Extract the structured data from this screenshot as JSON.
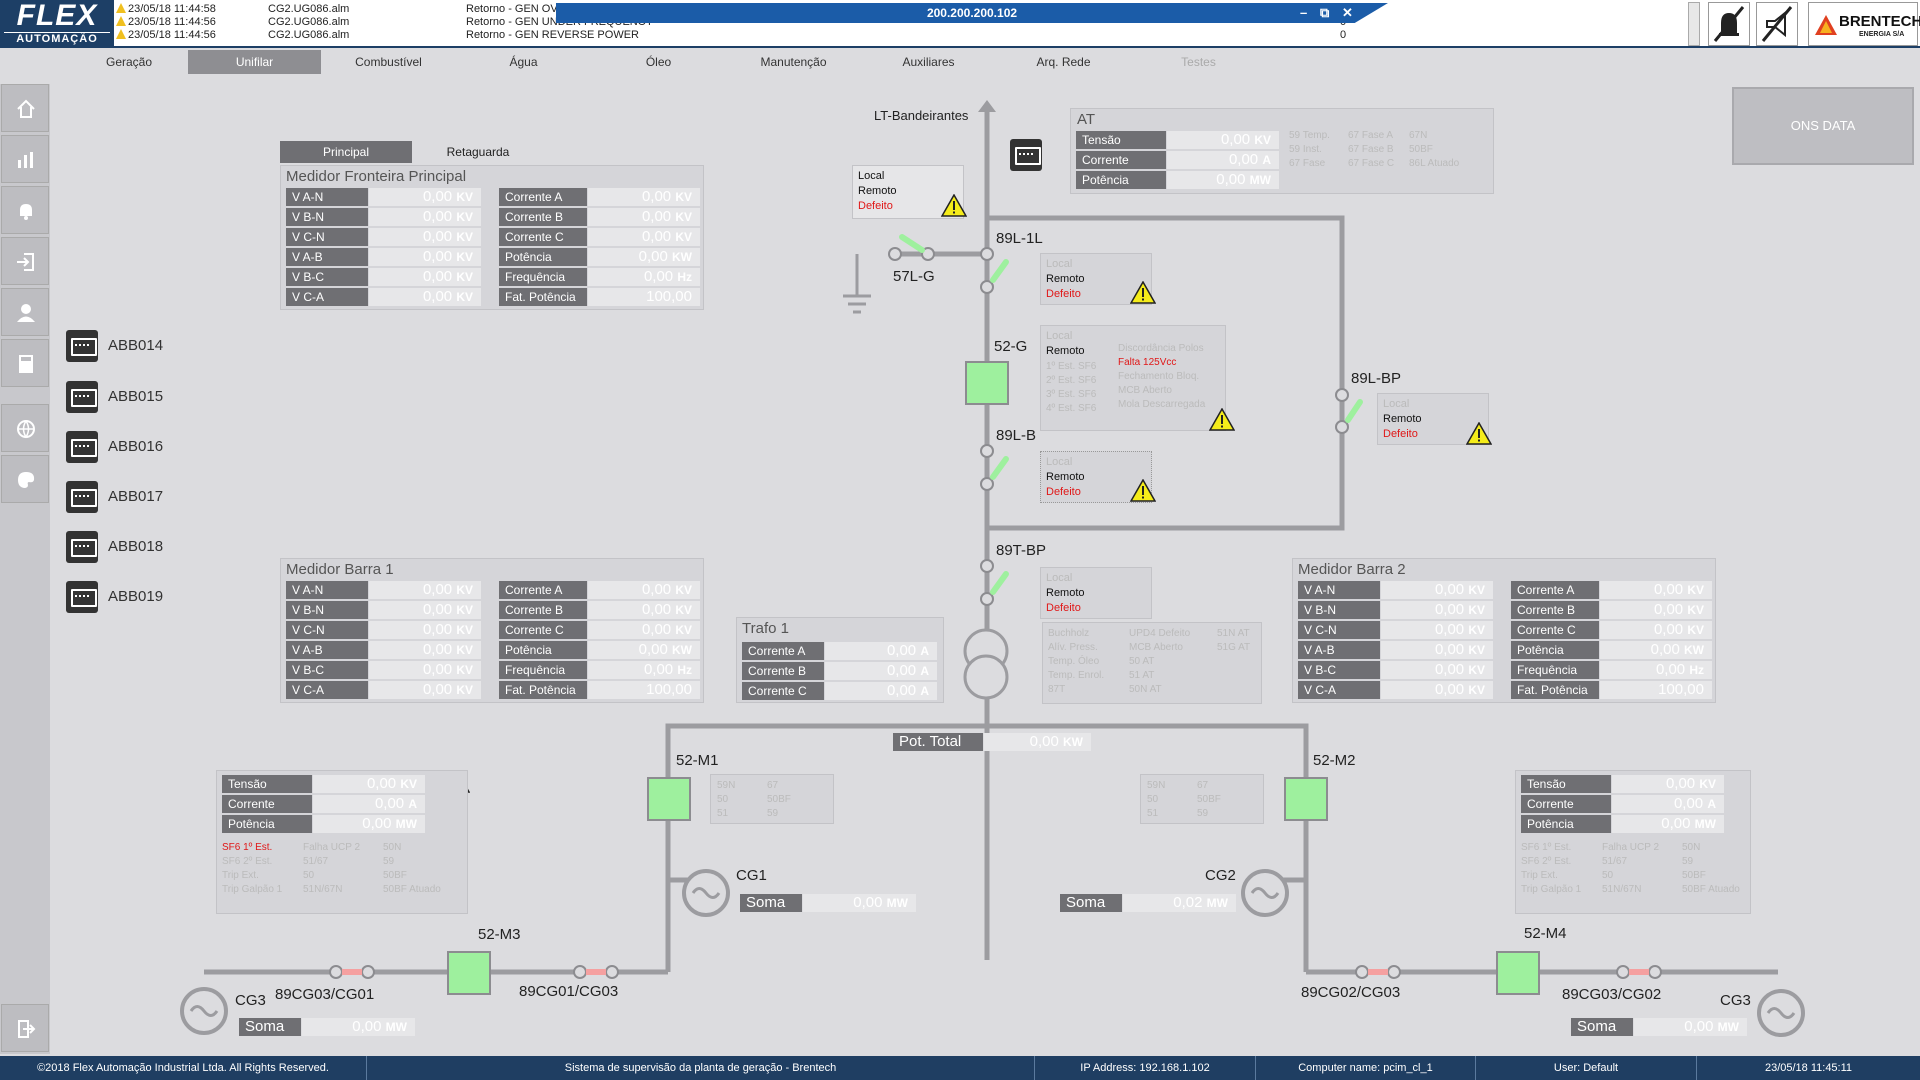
{
  "header": {
    "logo_line1": "FLEX",
    "logo_line2": "AUTOMAÇÃO",
    "ip": "200.200.200.102",
    "window_controls": [
      "–",
      "⧉",
      "✕"
    ],
    "brand": "BRENTECH",
    "brand_sub": "ENERGIA S/A",
    "alarms": [
      {
        "time": "23/05/18 11:44:58",
        "file": "CG2.UG086.alm",
        "msg": "Retorno - GEN OVERCURRENT",
        "val": "0"
      },
      {
        "time": "23/05/18 11:44:56",
        "file": "CG2.UG086.alm",
        "msg": "Retorno - GEN UNDER FREQUENCY",
        "val": "0"
      },
      {
        "time": "23/05/18 11:44:56",
        "file": "CG2.UG086.alm",
        "msg": "Retorno - GEN REVERSE POWER",
        "val": "0"
      }
    ]
  },
  "menu": [
    "Geração",
    "Unifilar",
    "Combustível",
    "Água",
    "Óleo",
    "Manutenção",
    "Auxiliares",
    "Arq. Rede",
    "Testes"
  ],
  "ons": "ONS DATA",
  "devices": [
    "ABB014",
    "ABB015",
    "ABB016",
    "ABB017",
    "ABB018",
    "ABB019"
  ],
  "tabs": {
    "principal": "Principal",
    "retaguarda": "Retaguarda"
  },
  "medidor_principal": {
    "title": "Medidor Fronteira Principal",
    "left": [
      [
        "V A-N",
        "0,00",
        "KV"
      ],
      [
        "V B-N",
        "0,00",
        "KV"
      ],
      [
        "V C-N",
        "0,00",
        "KV"
      ],
      [
        "V A-B",
        "0,00",
        "KV"
      ],
      [
        "V B-C",
        "0,00",
        "KV"
      ],
      [
        "V C-A",
        "0,00",
        "KV"
      ]
    ],
    "right": [
      [
        "Corrente A",
        "0,00",
        "KV"
      ],
      [
        "Corrente B",
        "0,00",
        "KV"
      ],
      [
        "Corrente C",
        "0,00",
        "KV"
      ],
      [
        "Potência",
        "0,00",
        "KW"
      ],
      [
        "Frequência",
        "0,00",
        "Hz"
      ],
      [
        "Fat. Potência",
        "100,00",
        ""
      ]
    ]
  },
  "medidor_barra1": {
    "title": "Medidor Barra 1",
    "left": [
      [
        "V A-N",
        "0,00",
        "KV"
      ],
      [
        "V B-N",
        "0,00",
        "KV"
      ],
      [
        "V C-N",
        "0,00",
        "KV"
      ],
      [
        "V A-B",
        "0,00",
        "KV"
      ],
      [
        "V B-C",
        "0,00",
        "KV"
      ],
      [
        "V C-A",
        "0,00",
        "KV"
      ]
    ],
    "right": [
      [
        "Corrente A",
        "0,00",
        "KV"
      ],
      [
        "Corrente B",
        "0,00",
        "KV"
      ],
      [
        "Corrente C",
        "0,00",
        "KV"
      ],
      [
        "Potência",
        "0,00",
        "KW"
      ],
      [
        "Frequência",
        "0,00",
        "Hz"
      ],
      [
        "Fat. Potência",
        "100,00",
        ""
      ]
    ]
  },
  "medidor_barra2": {
    "title": "Medidor Barra 2",
    "left": [
      [
        "V A-N",
        "0,00",
        "KV"
      ],
      [
        "V B-N",
        "0,00",
        "KV"
      ],
      [
        "V C-N",
        "0,00",
        "KV"
      ],
      [
        "V A-B",
        "0,00",
        "KV"
      ],
      [
        "V B-C",
        "0,00",
        "KV"
      ],
      [
        "V C-A",
        "0,00",
        "KV"
      ]
    ],
    "right": [
      [
        "Corrente A",
        "0,00",
        "KV"
      ],
      [
        "Corrente B",
        "0,00",
        "KV"
      ],
      [
        "Corrente C",
        "0,00",
        "KV"
      ],
      [
        "Potência",
        "0,00",
        "KW"
      ],
      [
        "Frequência",
        "0,00",
        "Hz"
      ],
      [
        "Fat. Potência",
        "100,00",
        ""
      ]
    ]
  },
  "trafo": {
    "title": "Trafo 1",
    "rows": [
      [
        "Corrente A",
        "0,00",
        "A"
      ],
      [
        "Corrente B",
        "0,00",
        "A"
      ],
      [
        "Corrente C",
        "0,00",
        "A"
      ]
    ]
  },
  "at": {
    "title": "AT",
    "rows": [
      [
        "Tensão",
        "0,00",
        "KV"
      ],
      [
        "Corrente",
        "0,00",
        "A"
      ],
      [
        "Potência",
        "0,00",
        "MW"
      ]
    ],
    "flags": [
      "59 Temp.",
      "67 Fase A",
      "67N",
      "59 Inst.",
      "67 Fase B",
      "50BF",
      "67 Fase",
      "67 Fase C",
      "86L Atuado"
    ]
  },
  "pot_total": {
    "label": "Pot. Total",
    "value": "0,00",
    "unit": "KW"
  },
  "labels": {
    "lt": "LT-Bandeirantes",
    "l89_1l": "89L-1L",
    "l57": "57L-G",
    "l52g": "52-G",
    "l89lb": "89L-B",
    "l89lbp": "89L-BP",
    "l89tbp": "89T-BP",
    "m1": "52-M1",
    "m2": "52-M2",
    "m3": "52-M3",
    "m4": "52-M4",
    "cg1": "CG1",
    "cg2": "CG2",
    "cg3a": "CG3",
    "cg3b": "CG3",
    "s1": "89CG03/CG01",
    "s2": "89CG01/CG03",
    "s3": "89CG02/CG03",
    "s4": "89CG03/CG02"
  },
  "lrd": {
    "local": "Local",
    "remoto": "Remoto",
    "defeito": "Defeito"
  },
  "g52_flags": [
    "Discordância Polos",
    "Falta 125Vcc",
    "Fechamento Bloq.",
    "MCB Aberto",
    "Mola Descarregada"
  ],
  "g52_est": [
    "1º Est. SF6",
    "2º Est. SF6",
    "3º Est. SF6",
    "4º Est. SF6"
  ],
  "trafo_flags": [
    "Buchholz",
    "UPD4 Defeito",
    "51N AT",
    "Alív. Press.",
    "MCB Aberto",
    "51G AT",
    "Temp. Óleo",
    "50 AT",
    "Temp. Enrol.",
    "51 AT",
    "87T",
    "50N AT"
  ],
  "m_flags": [
    "59N",
    "67",
    "50",
    "50BF",
    "51",
    "59"
  ],
  "gen_left": {
    "rows": [
      [
        "Tensão",
        "0,00",
        "KV"
      ],
      [
        "Corrente",
        "0,00",
        "A"
      ],
      [
        "Potência",
        "0,00",
        "MW"
      ]
    ],
    "flags": [
      "SF6 1º Est.",
      "Falha UCP 2",
      "50N",
      "SF6 2º Est.",
      "51/67",
      "59",
      "Trip Ext.",
      "50",
      "50BF",
      "Trip Galpão 1",
      "51N/67N",
      "50BF Atuado"
    ]
  },
  "gen_right": {
    "rows": [
      [
        "Tensão",
        "0,00",
        "KV"
      ],
      [
        "Corrente",
        "0,00",
        "A"
      ],
      [
        "Potência",
        "0,00",
        "MW"
      ]
    ],
    "flags": [
      "SF6 1º Est.",
      "Falha UCP 2",
      "50N",
      "SF6 2º Est.",
      "51/67",
      "59",
      "Trip Ext.",
      "50",
      "50BF",
      "Trip Galpão 1",
      "51N/67N",
      "50BF Atuado"
    ]
  },
  "soma": {
    "label": "Soma",
    "cg1": "0,00",
    "cg2": "0,02",
    "cg3a": "0,00",
    "cg3b": "0,00",
    "unit": "MW"
  },
  "status": {
    "copyright": "©2018 Flex Automação Industrial Ltda. All Rights Reserved.",
    "system": "Sistema de supervisão da planta de geração - Brentech",
    "ip": "IP Address: 192.168.1.102",
    "computer": "Computer name: pcim_cl_1",
    "user": "User: Default",
    "datetime": "23/05/18 11:45:11"
  },
  "colors": {
    "closed": "#9ef09e",
    "open_switch": "#f5a0a0",
    "line": "#9c9ca0",
    "alarm_red": "#e01818"
  }
}
